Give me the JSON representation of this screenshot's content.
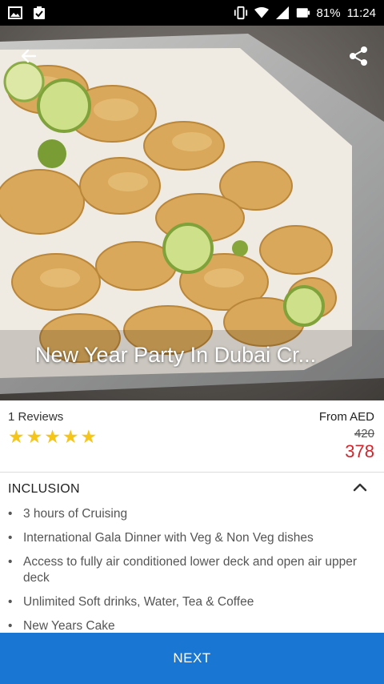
{
  "status_bar": {
    "battery": "81%",
    "time": "11:24",
    "icons": [
      "image-icon",
      "clipboard-check-icon",
      "vibrate-icon",
      "wifi-icon",
      "signal-icon",
      "battery-icon"
    ]
  },
  "hero": {
    "title": "New Year Party In Dubai Cr...",
    "back_icon": "arrow-left-icon",
    "share_icon": "share-icon"
  },
  "reviews": {
    "count_label": "1 Reviews",
    "rating": 5,
    "stars": [
      "★",
      "★",
      "★",
      "★",
      "★"
    ]
  },
  "price": {
    "from_label": "From AED",
    "original": "420",
    "current": "378",
    "current_color": "#d0262d"
  },
  "inclusion": {
    "header": "INCLUSION",
    "toggle_icon": "chevron-up-icon",
    "items": [
      "3 hours of Cruising",
      "International Gala Dinner with Veg & Non Veg dishes",
      "Access to fully air conditioned lower deck and open air upper deck",
      "Unlimited Soft drinks, Water, Tea & Coffee",
      "New Years Cake"
    ]
  },
  "next_button": {
    "label": "NEXT",
    "color": "#1976d2"
  }
}
